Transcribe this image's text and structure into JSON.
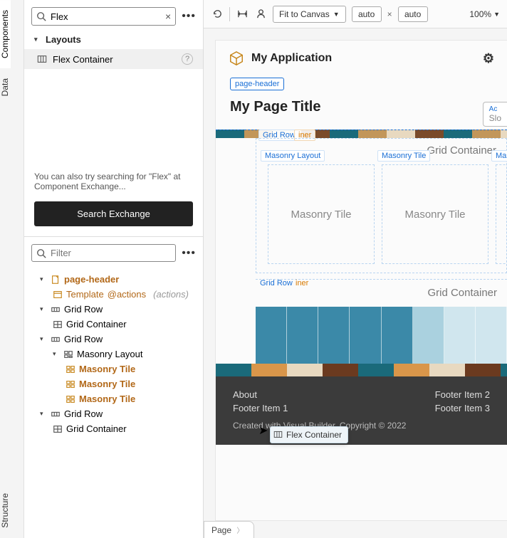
{
  "rail": {
    "components": "Components",
    "data": "Data",
    "structure": "Structure"
  },
  "search": {
    "value": "Flex",
    "clear": "×",
    "category": "Layouts",
    "result": "Flex Container",
    "help": "?",
    "more": "•••"
  },
  "exchange": {
    "hint": "You can also try searching for \"Flex\" at Component Exchange...",
    "button": "Search Exchange"
  },
  "filter": {
    "placeholder": "Filter",
    "more": "•••"
  },
  "tree": {
    "pageHeader": "page-header",
    "template": "Template",
    "actions": "@actions",
    "actionsParen": "(actions)",
    "gridRow": "Grid Row",
    "gridContainer": "Grid Container",
    "masonryLayout": "Masonry Layout",
    "masonryTile": "Masonry Tile"
  },
  "toolbar": {
    "fit": "Fit to Canvas",
    "w": "auto",
    "h": "auto",
    "zoom": "100%"
  },
  "canvas": {
    "appName": "My Application",
    "phTag": "page-header",
    "title": "My Page Title",
    "actionsSlot": "Ac",
    "slotHint": "Slo",
    "gridRow": "Grid Row",
    "iner": "iner",
    "gridContainer": "Grid Container",
    "masonryLayout": "Masonry Layout",
    "masonryTile": "Masonry Tile",
    "masoTrunc": "Maso",
    "dragBadge": "Flex Container"
  },
  "footer": {
    "about": "About",
    "f1": "Footer Item 1",
    "f2": "Footer Item 2",
    "f3": "Footer Item 3",
    "copyright": "Created with Visual Builder, Copyright © 2022"
  },
  "bottomTab": "Page"
}
